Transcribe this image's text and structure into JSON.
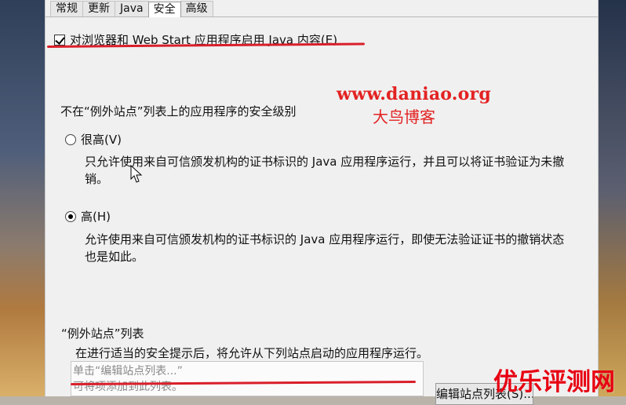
{
  "tabs": [
    {
      "label": "常规"
    },
    {
      "label": "更新"
    },
    {
      "label": "Java"
    },
    {
      "label": "安全"
    },
    {
      "label": "高级"
    }
  ],
  "security": {
    "checkbox_label": "对浏览器和 Web Start 应用程序启用 Java 内容(E)",
    "section_label": "不在“例外站点”列表上的应用程序的安全级别",
    "very_high_label": "很高(V)",
    "very_high_desc": "只允许使用来自可信颁发机构的证书标识的 Java 应用程序运行，并且可以将证书验证为未撤销。",
    "high_label": "高(H)",
    "high_desc": "允许使用来自可信颁发机构的证书标识的 Java 应用程序运行，即使无法验证证书的撤销状态也是如此。"
  },
  "exception_sites": {
    "title": "“例外站点”列表",
    "desc": "在进行适当的安全提示后，将允许从下列站点启动的应用程序运行。",
    "list_line_1": "单击“编辑站点列表...”",
    "list_line_2": "可将项添加到此列表。",
    "button_label": "编辑站点列表(S)..."
  },
  "watermarks": {
    "url": "www.daniao.org",
    "name": "大鸟博客",
    "corner": "优乐评测网"
  },
  "colors": {
    "accent_red": "#e32222",
    "corner_red": "#e70012"
  }
}
